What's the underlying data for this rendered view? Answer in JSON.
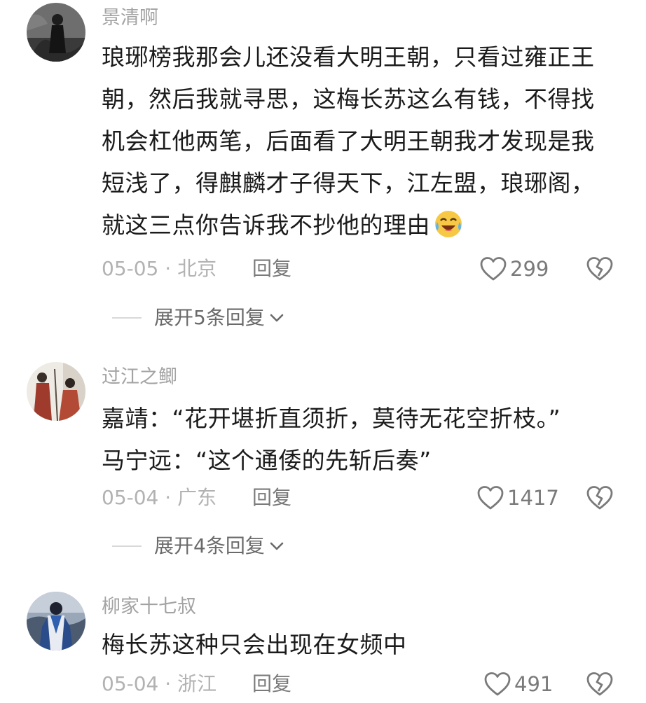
{
  "comments": [
    {
      "username": "景清啊",
      "lines": [
        "琅琊榜我那会儿还没看大明王朝，只看过雍正王",
        "朝，然后我就寻思，这梅长苏这么有钱，不得找",
        "机会杠他两笔，后面看了大明王朝我才发现是我",
        "短浅了，得麒麟才子得天下，江左盟，琅琊阁，",
        "就这三点你告诉我不抄他的理由"
      ],
      "emoji": "crying-laughing-emoji",
      "date_location": "05-05 · 北京",
      "reply_label": "回复",
      "like_count": "299",
      "expand_label": "展开5条回复"
    },
    {
      "username": "过江之鲫",
      "lines": [
        "嘉靖：“花开堪折直须折，莫待无花空折枝。”",
        "马宁远：“这个通倭的先斩后奏”"
      ],
      "date_location": "05-04 · 广东",
      "reply_label": "回复",
      "like_count": "1417",
      "expand_label": "展开4条回复"
    },
    {
      "username": "柳家十七叔",
      "lines": [
        "梅长苏这种只会出现在女频中"
      ],
      "date_location": "05-04 · 浙江",
      "reply_label": "回复",
      "like_count": "491"
    }
  ],
  "icons": {
    "like": "heart-outline-icon",
    "dislike": "broken-heart-icon",
    "expand": "chevron-down-icon"
  },
  "colors": {
    "text": "#1b1b1b",
    "username": "#a3a3a3",
    "meta": "#b2b2b2",
    "action": "#7a7a7a"
  }
}
